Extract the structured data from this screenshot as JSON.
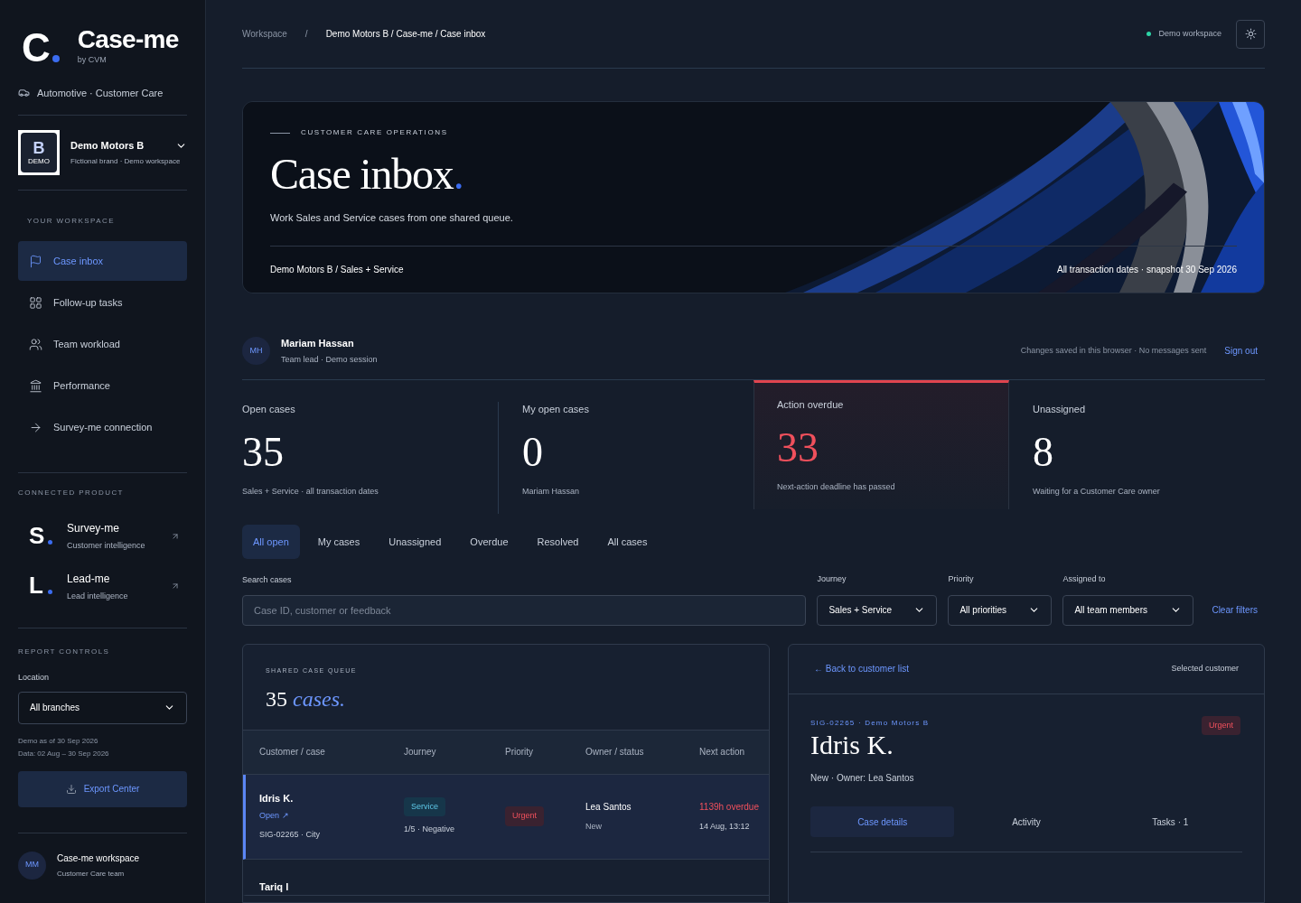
{
  "brand": {
    "letter": "C",
    "name": "Case-me",
    "byline": "by CVM",
    "sector": "Automotive · Customer Care"
  },
  "workspace": {
    "logo_letter": "B",
    "logo_tag": "DEMO",
    "name": "Demo Motors B",
    "subtitle": "Fictional brand · Demo workspace"
  },
  "nav": {
    "heading": "YOUR WORKSPACE",
    "items": [
      {
        "label": "Case inbox",
        "selected": true
      },
      {
        "label": "Follow-up tasks",
        "selected": false
      },
      {
        "label": "Team workload",
        "selected": false
      },
      {
        "label": "Performance",
        "selected": false
      },
      {
        "label": "Survey-me connection",
        "selected": false
      }
    ]
  },
  "connected": {
    "heading": "CONNECTED PRODUCT",
    "items": [
      {
        "letter": "S",
        "name": "Survey-me",
        "subtitle": "Customer intelligence"
      },
      {
        "letter": "L",
        "name": "Lead-me",
        "subtitle": "Lead intelligence"
      }
    ]
  },
  "report_controls": {
    "heading": "REPORT CONTROLS",
    "location_label": "Location",
    "location_value": "All branches",
    "notes": [
      "Demo as of 30 Sep 2026",
      "Data: 02 Aug – 30 Sep 2026"
    ],
    "export_button": "Export Center"
  },
  "account": {
    "initials": "MM",
    "name": "Case-me workspace",
    "team": "Customer Care team"
  },
  "breadcrumb": {
    "root": "Workspace",
    "separator": "/",
    "current": "Demo Motors B / Case-me / Case inbox"
  },
  "workspace_badge": "Demo workspace",
  "hero": {
    "eyebrow": "CUSTOMER CARE OPERATIONS",
    "title": "Case inbox",
    "title_dot": ".",
    "subtitle": "Work Sales and Service cases from one shared queue.",
    "footer_left": "Demo Motors B / Sales + Service",
    "footer_right": "All transaction dates · snapshot 30 Sep 2026"
  },
  "user": {
    "initials": "MH",
    "name": "Mariam Hassan",
    "role": "Team lead · Demo session",
    "note": "Changes saved in this browser · No messages sent",
    "sign_out": "Sign out"
  },
  "stats": [
    {
      "label": "Open cases",
      "value": "35",
      "caption": "Sales + Service · all transaction dates",
      "alert": false
    },
    {
      "label": "My open cases",
      "value": "0",
      "caption": "Mariam Hassan",
      "alert": false
    },
    {
      "label": "Action overdue",
      "value": "33",
      "caption": "Next-action deadline has passed",
      "alert": true
    },
    {
      "label": "Unassigned",
      "value": "8",
      "caption": "Waiting for a Customer Care owner",
      "alert": false
    }
  ],
  "tabs": [
    {
      "label": "All open",
      "selected": true
    },
    {
      "label": "My cases",
      "selected": false
    },
    {
      "label": "Unassigned",
      "selected": false
    },
    {
      "label": "Overdue",
      "selected": false
    },
    {
      "label": "Resolved",
      "selected": false
    },
    {
      "label": "All cases",
      "selected": false
    }
  ],
  "filters": {
    "search_label": "Search cases",
    "search_placeholder": "Case ID, customer or feedback",
    "selects": [
      {
        "label": "Journey",
        "value": "Sales + Service"
      },
      {
        "label": "Priority",
        "value": "All priorities"
      },
      {
        "label": "Assigned to",
        "value": "All team members"
      }
    ],
    "clear": "Clear filters"
  },
  "queue": {
    "eyebrow": "SHARED CASE QUEUE",
    "count": "35",
    "count_word": "cases.",
    "columns": [
      "Customer / case",
      "Journey",
      "Priority",
      "Owner / status",
      "Next action"
    ],
    "rows": [
      {
        "name": "Idris K.",
        "status_link": "Open ↗",
        "case_ref": "SIG-02265 · City",
        "journey": "Service",
        "score": "1/5 · Negative",
        "priority": "Urgent",
        "owner": "Lea Santos",
        "owner_status": "New",
        "due": "1139h overdue",
        "due_date": "14 Aug, 13:12",
        "selected": true
      },
      {
        "name": "Tariq I",
        "selected": false
      }
    ]
  },
  "detail": {
    "back": "← Back to customer list",
    "header_note": "Selected customer",
    "ref": "SIG-02265 · Demo Motors B",
    "priority": "Urgent",
    "name": "Idris K.",
    "meta": "New · Owner: Lea Santos",
    "tabs": [
      {
        "label": "Case details",
        "selected": true
      },
      {
        "label": "Activity",
        "selected": false
      },
      {
        "label": "Tasks · 1",
        "selected": false
      }
    ]
  }
}
